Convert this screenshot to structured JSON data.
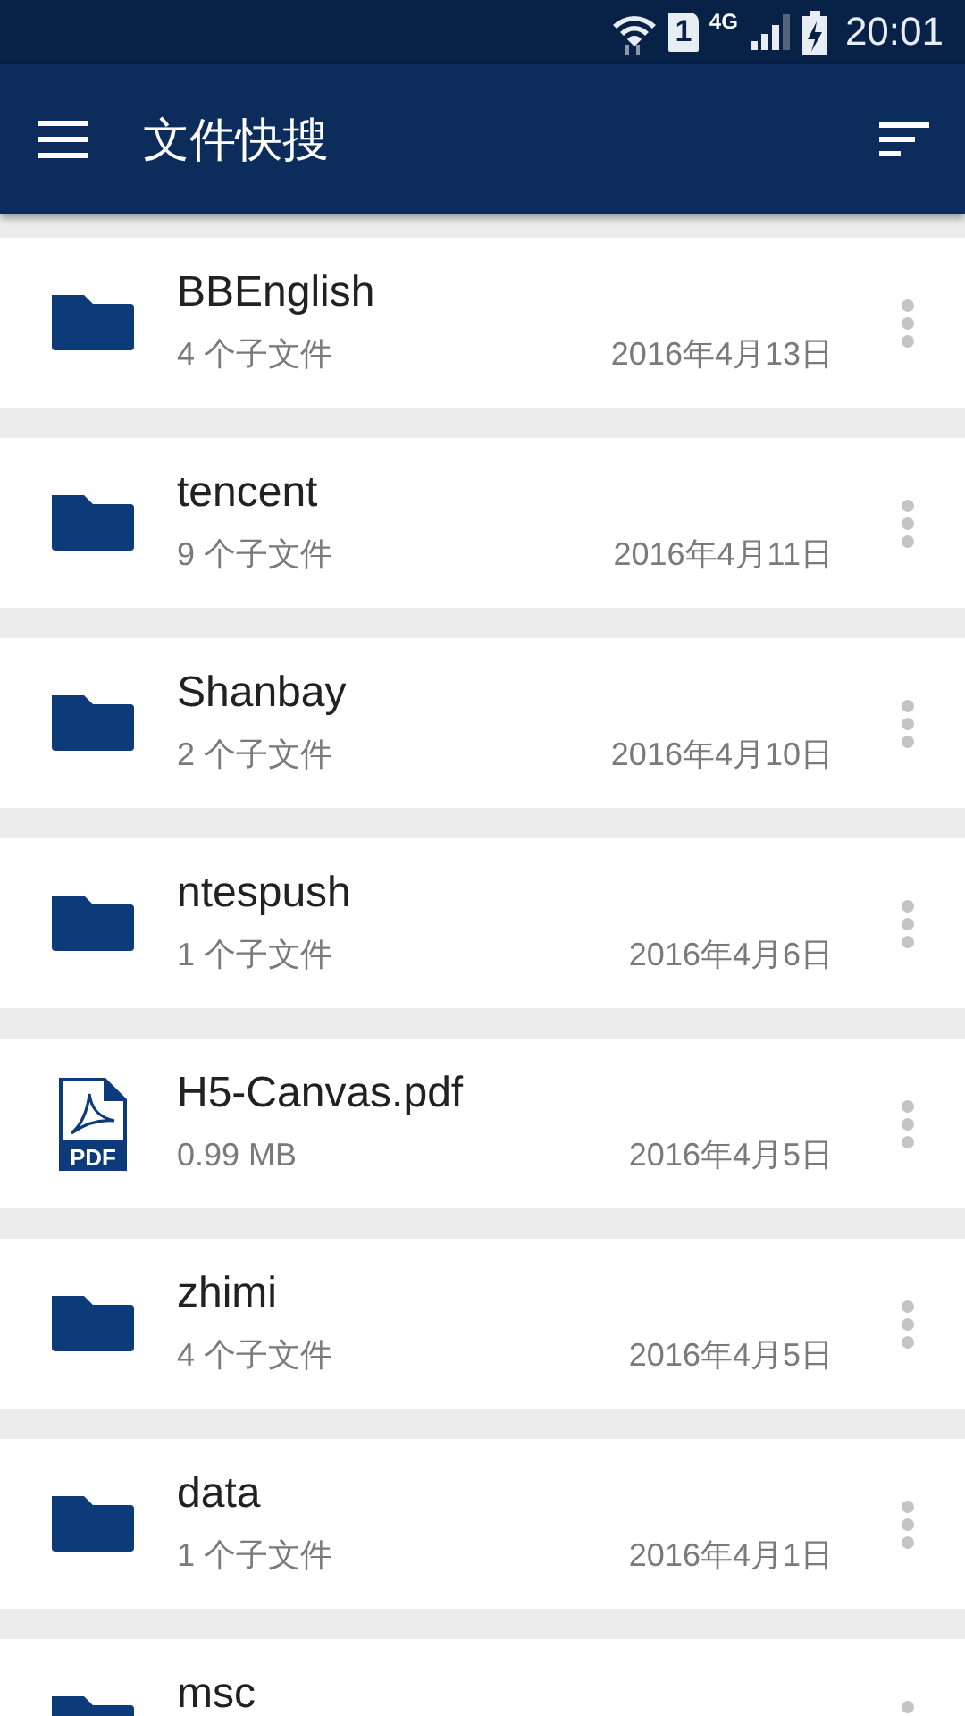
{
  "status_bar": {
    "sim": "1",
    "network": "4G",
    "time": "20:01"
  },
  "toolbar": {
    "title": "文件快搜"
  },
  "files": [
    {
      "kind": "folder",
      "name": "BBEnglish",
      "detail": "4 个子文件",
      "date": "2016年4月13日"
    },
    {
      "kind": "folder",
      "name": "tencent",
      "detail": "9 个子文件",
      "date": "2016年4月11日"
    },
    {
      "kind": "folder",
      "name": "Shanbay",
      "detail": "2 个子文件",
      "date": "2016年4月10日"
    },
    {
      "kind": "folder",
      "name": "ntespush",
      "detail": "1 个子文件",
      "date": "2016年4月6日"
    },
    {
      "kind": "pdf",
      "icon_text": "PDF",
      "name": "H5-Canvas.pdf",
      "detail": "0.99 MB",
      "date": "2016年4月5日"
    },
    {
      "kind": "folder",
      "name": "zhimi",
      "detail": "4 个子文件",
      "date": "2016年4月5日"
    },
    {
      "kind": "folder",
      "name": "data",
      "detail": "1 个子文件",
      "date": "2016年4月1日"
    },
    {
      "kind": "folder",
      "name": "msc"
    }
  ]
}
